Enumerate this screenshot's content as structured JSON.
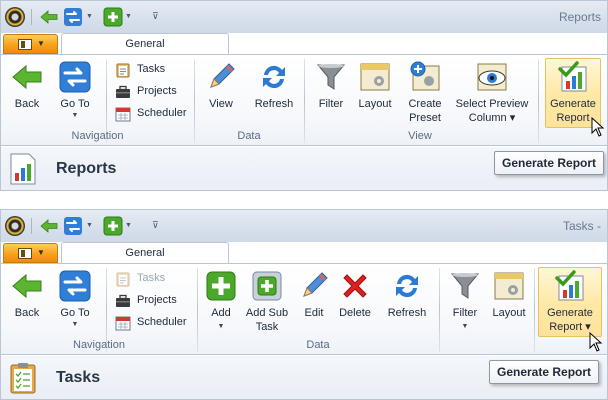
{
  "top": {
    "window_title": "Reports",
    "tab": "General",
    "groups": {
      "navigation": "Navigation",
      "data": "Data",
      "view": "View"
    },
    "buttons": {
      "back": "Back",
      "goto": "Go To",
      "tasks": "Tasks",
      "projects": "Projects",
      "scheduler": "Scheduler",
      "view": "View",
      "refresh": "Refresh",
      "filter": "Filter",
      "layout": "Layout",
      "create_preset_1": "Create",
      "create_preset_2": "Preset",
      "select_preview_1": "Select Preview",
      "select_preview_2": "Column",
      "generate_report_1": "Generate",
      "generate_report_2": "Report"
    },
    "page_title": "Reports",
    "tooltip": "Generate Report"
  },
  "bottom": {
    "window_title": "Tasks -",
    "tab": "General",
    "groups": {
      "navigation": "Navigation",
      "data": "Data"
    },
    "buttons": {
      "back": "Back",
      "goto": "Go To",
      "tasks": "Tasks",
      "projects": "Projects",
      "scheduler": "Scheduler",
      "add": "Add",
      "add_sub_task_1": "Add Sub",
      "add_sub_task_2": "Task",
      "edit": "Edit",
      "delete": "Delete",
      "refresh": "Refresh",
      "filter": "Filter",
      "layout": "Layout",
      "generate_report_1": "Generate",
      "generate_report_2": "Report"
    },
    "page_title": "Tasks",
    "tooltip": "Generate Report"
  },
  "icons": {
    "app": "app-logo-icon",
    "qat_back": "arrow-left-icon",
    "qat_switch": "swap-icon",
    "qat_add": "plus-icon",
    "customize": "customize-qat-icon"
  },
  "colors": {
    "accent_orange": "#f7a21c",
    "highlight": "#ffe9a8",
    "green": "#4aa82a",
    "blue": "#2b7bd4",
    "red": "#e02020"
  }
}
